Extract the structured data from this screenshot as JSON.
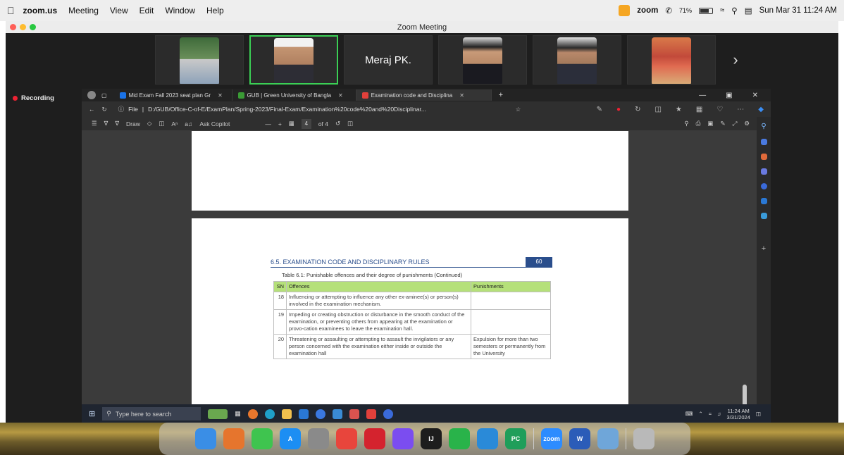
{
  "menubar": {
    "app_name": "zoom.us",
    "menus": [
      "Meeting",
      "View",
      "Edit",
      "Window",
      "Help"
    ],
    "status_brand": "zoom",
    "battery": "71%",
    "datetime": "Sun Mar 31  11:24 AM"
  },
  "zoom": {
    "window_title": "Zoom Meeting",
    "participant_name": "Meraj PK.",
    "recording_label": "Recording"
  },
  "browser": {
    "tabs": [
      {
        "label": "Mid Exam Fall 2023 seat plan Gr",
        "color": "#1a73e8"
      },
      {
        "label": "GUB | Green University of Bangla",
        "color": "#3a9b35"
      },
      {
        "label": "Examination code and Disciplina",
        "color": "#e2403b"
      }
    ],
    "address_prefix": "File",
    "address": "D:/GUB/Office-C-of-E/ExamPlan/Spring-2023/Final-Exam/Examination%20code%20and%20Disciplinar...",
    "toolbar": {
      "draw_label": "Draw",
      "copilot_label": "Ask Copilot",
      "page_current": "4",
      "page_total": "of 4"
    }
  },
  "document": {
    "section_title": "6.5. EXAMINATION CODE AND DISCIPLINARY RULES",
    "page_number": "60",
    "table_caption": "Table 6.1: Punishable offences and their degree of punishments (Continued)",
    "columns": [
      "SN",
      "Offences",
      "Punishments"
    ],
    "rows": [
      {
        "sn": "18",
        "offence": "Influencing or attempting to influence any other ex-aminee(s) or person(s) involved in the examination mechanism.",
        "punishment": ""
      },
      {
        "sn": "19",
        "offence": "Impeding or creating obstruction or disturbance in the smooth conduct of the examination, or preventing others from appearing at the examination or provo-cation examinees to leave the examination hall.",
        "punishment": ""
      },
      {
        "sn": "20",
        "offence": "Threatening or assaulting or attempting to assault the invigilators or any person concerned with the examination either inside or outside the examination hall",
        "punishment": "Expulsion for more than two semesters or permanently from the University"
      }
    ]
  },
  "taskbar": {
    "search_placeholder": "Type here to search",
    "time": "11:24 AM",
    "date": "3/31/2024"
  },
  "dock": {
    "apps": [
      {
        "name": "finder",
        "label": "",
        "color": "#3a8ee6"
      },
      {
        "name": "launchpad",
        "label": "",
        "color": "#e6752d"
      },
      {
        "name": "messages",
        "label": "",
        "color": "#3fc44f"
      },
      {
        "name": "app-store",
        "label": "A",
        "color": "#1c8ef3"
      },
      {
        "name": "settings",
        "label": "",
        "color": "#8a8a8a"
      },
      {
        "name": "chrome",
        "label": "",
        "color": "#e8453c"
      },
      {
        "name": "opera",
        "label": "",
        "color": "#d4232e"
      },
      {
        "name": "messenger",
        "label": "",
        "color": "#7b4df0"
      },
      {
        "name": "intellij",
        "label": "IJ",
        "color": "#1d1d1d"
      },
      {
        "name": "whatsapp",
        "label": "",
        "color": "#29b34a"
      },
      {
        "name": "vscode",
        "label": "",
        "color": "#2a8ad8"
      },
      {
        "name": "pycharm",
        "label": "PC",
        "color": "#1f9e5a"
      },
      {
        "name": "zoom",
        "label": "zoom",
        "color": "#2d8cff"
      },
      {
        "name": "word",
        "label": "W",
        "color": "#2b5cb8"
      },
      {
        "name": "preview",
        "label": "",
        "color": "#6fa6d9"
      },
      {
        "name": "trash",
        "label": "",
        "color": "#b9b9b9"
      }
    ]
  }
}
